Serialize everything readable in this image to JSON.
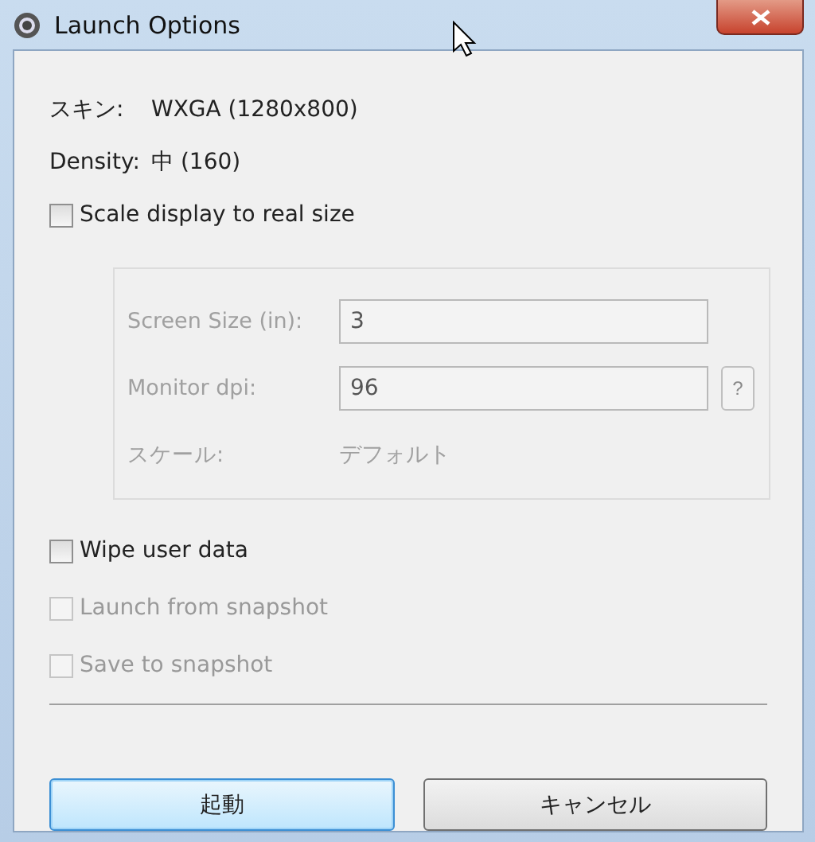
{
  "window": {
    "title": "Launch Options"
  },
  "info": [
    {
      "label": "スキン:",
      "value": "WXGA (1280x800)"
    },
    {
      "label": "Density:",
      "value": "中 (160)"
    }
  ],
  "scale_checkbox": {
    "label": "Scale display to real size",
    "checked": false,
    "disabled": false
  },
  "scale_group": {
    "disabled": true,
    "fields": [
      {
        "label": "Screen Size (in):",
        "value": "3"
      },
      {
        "label": "Monitor dpi:",
        "value": "96",
        "help": "?"
      }
    ],
    "scale": {
      "label": "スケール:",
      "value": "デフォルト"
    }
  },
  "options": [
    {
      "label": "Wipe user data",
      "checked": false,
      "disabled": false
    },
    {
      "label": "Launch from snapshot",
      "checked": false,
      "disabled": true
    },
    {
      "label": "Save to snapshot",
      "checked": false,
      "disabled": true
    }
  ],
  "buttons": [
    {
      "label": "起動",
      "default": true
    },
    {
      "label": "キャンセル",
      "default": false
    }
  ]
}
